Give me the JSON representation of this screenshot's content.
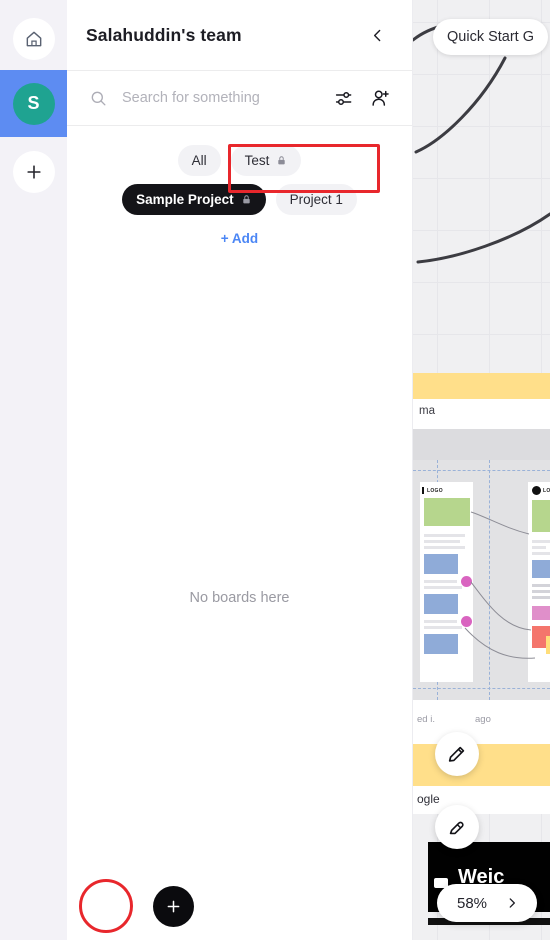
{
  "rail": {
    "items": [
      {
        "name": "home",
        "icon": "home-icon",
        "label": "",
        "selected": false
      },
      {
        "name": "team-avatar",
        "icon": "avatar",
        "label": "S",
        "selected": true
      },
      {
        "name": "add-workspace",
        "icon": "plus-icon",
        "label": "",
        "selected": false
      }
    ]
  },
  "panel": {
    "title": "Salahuddin's team",
    "collapse_icon": "chevron-left-icon",
    "search": {
      "placeholder": "Search for something",
      "value": "",
      "search_icon": "search-icon",
      "filter_icon": "filter-sliders-icon",
      "invite_icon": "add-person-icon"
    },
    "tags": [
      {
        "label": "All",
        "locked": false,
        "active": false
      },
      {
        "label": "Test",
        "locked": true,
        "active": false
      },
      {
        "label": "Sample Project",
        "locked": true,
        "active": true
      },
      {
        "label": "Project 1",
        "locked": false,
        "active": false
      }
    ],
    "add_tag_label": "+ Add",
    "empty_state": "No boards here",
    "fab_icon": "plus-icon"
  },
  "canvas": {
    "quick_start_label": "Quick Start G",
    "zoom_level": "58%",
    "zoom_chevron": "chevron-right-icon",
    "pencil_icon": "pencil-icon",
    "highlighter_icon": "highlighter-icon",
    "fragment_figma": "ma",
    "fragment_meta_left": "ed i.",
    "fragment_meta_right": "ago",
    "fragment_google": "ogle",
    "fragment_black_card": "Weic",
    "wireframe_logo_label": "LOGO"
  },
  "colors": {
    "accent_blue": "#5d8cf2",
    "avatar_teal": "#1fa391",
    "active_tag": "#141418",
    "link_blue": "#4b86f5",
    "annotation_red": "#e8272c",
    "canvas_bg": "#f0f0f2",
    "rail_bg": "#f3f2f7"
  }
}
